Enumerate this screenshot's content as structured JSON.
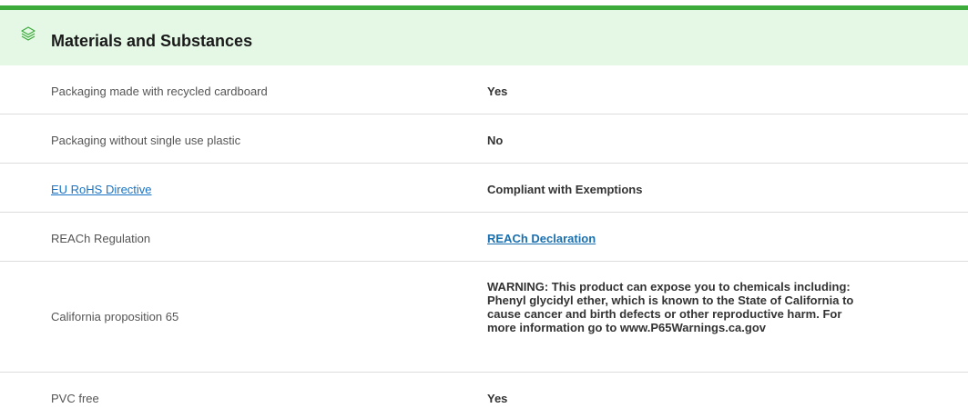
{
  "section": {
    "title": "Materials and Substances",
    "icon": "layers-icon",
    "accent_color": "#3dab3c",
    "header_bg": "#e5f8e6"
  },
  "rows": [
    {
      "label": "Packaging made with recycled cardboard",
      "value": "Yes"
    },
    {
      "label": "Packaging without single use plastic",
      "value": "No"
    },
    {
      "label": "EU RoHS Directive",
      "value": "Compliant with Exemptions"
    },
    {
      "label": "REACh Regulation",
      "value": "REACh Declaration"
    },
    {
      "label": "California proposition 65",
      "value": "WARNING: This product can expose you to chemicals including: Phenyl glycidyl ether, which is known to the State of California to cause cancer and birth defects or other reproductive harm. For more information go to www.P65Warnings.ca.gov"
    },
    {
      "label": "PVC free",
      "value": "Yes"
    }
  ]
}
